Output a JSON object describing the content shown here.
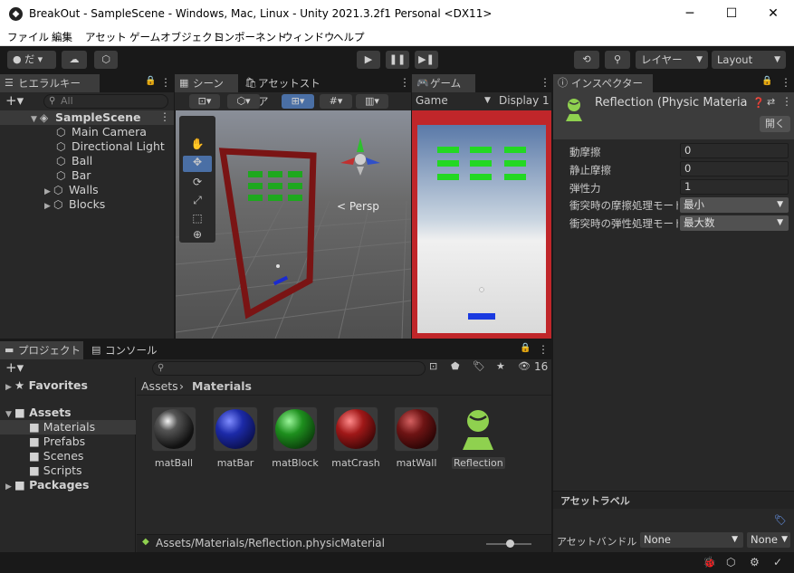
{
  "window": {
    "title": "BreakOut - SampleScene - Windows, Mac, Linux - Unity 2021.3.2f1 Personal <DX11>",
    "minimize": "─",
    "maximize": "☐",
    "close": "✕"
  },
  "menu": [
    "ファイル",
    "編集",
    "アセット",
    "ゲームオブジェクト",
    "コンポーネント",
    "ウィンドウ",
    "ヘルプ"
  ],
  "toolbar": {
    "account_label": "だ",
    "layers_label": "レイヤー",
    "layout_label": "Layout"
  },
  "hierarchy": {
    "tab_label": "ヒエラルキー",
    "search_placeholder": "All",
    "scene_name": "SampleScene",
    "items": [
      "Main Camera",
      "Directional Light",
      "Ball",
      "Bar",
      "Walls",
      "Blocks"
    ]
  },
  "scene": {
    "tab_label": "シーン",
    "asset_store_label": "アセットストア",
    "persp_label": "< Persp"
  },
  "game": {
    "tab_label": "ゲーム",
    "mode_label": "Game",
    "display_label": "Display 1"
  },
  "inspector": {
    "tab_label": "インスペクター",
    "object_name": "Reflection (Physic Materia",
    "open_button": "開く",
    "properties": [
      {
        "label": "動摩擦",
        "value": "0"
      },
      {
        "label": "静止摩擦",
        "value": "0"
      },
      {
        "label": "弾性力",
        "value": "1"
      }
    ],
    "combine": [
      {
        "label": "衝突時の摩擦処理モード",
        "value": "最小"
      },
      {
        "label": "衝突時の弾性処理モード",
        "value": "最大数"
      }
    ],
    "asset_labels_title": "アセットラベル",
    "asset_bundle_label": "アセットバンドル",
    "bundle_value": "None",
    "variant_value": "None"
  },
  "project": {
    "tab_label": "プロジェクト",
    "console_label": "コンソール",
    "hidden_count": "16",
    "favorites_label": "Favorites",
    "assets_label": "Assets",
    "folders": [
      "Materials",
      "Prefabs",
      "Scenes",
      "Scripts"
    ],
    "packages_label": "Packages",
    "breadcrumb_root": "Assets",
    "breadcrumb_current": "Materials",
    "assets": [
      {
        "name": "matBall",
        "color": "#2a2a2a"
      },
      {
        "name": "matBar",
        "color": "#1c2aa8"
      },
      {
        "name": "matBlock",
        "color": "#1e8f1e"
      },
      {
        "name": "matCrash",
        "color": "#a01818"
      },
      {
        "name": "matWall",
        "color": "#6e1414"
      },
      {
        "name": "Reflection",
        "color": "#8fd14f"
      }
    ],
    "status_path": "Assets/Materials/Reflection.physicMaterial"
  }
}
